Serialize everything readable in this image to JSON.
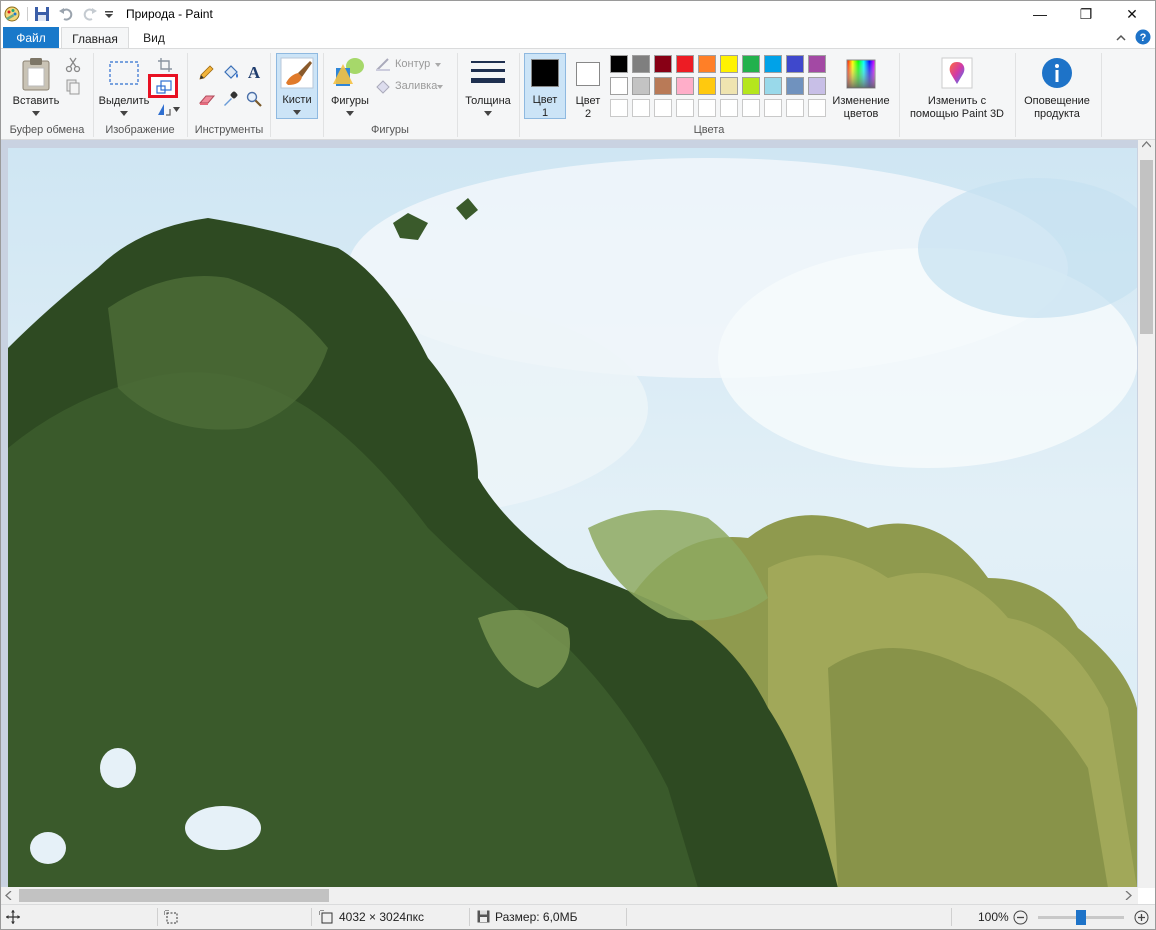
{
  "window": {
    "title": "Природа - Paint",
    "minimize": "—",
    "restore": "❐",
    "close": "✕"
  },
  "tabs": {
    "file": "Файл",
    "home": "Главная",
    "view": "Вид"
  },
  "ribbon": {
    "clipboard": {
      "group_label": "Буфер обмена",
      "paste": "Вставить"
    },
    "image": {
      "group_label": "Изображение",
      "select": "Выделить"
    },
    "tools": {
      "group_label": "Инструменты"
    },
    "brushes": {
      "label": "Кисти"
    },
    "shapes": {
      "group_label": "Фигуры",
      "shapes_label": "Фигуры",
      "outline": "Контур",
      "fill": "Заливка"
    },
    "size": {
      "label": "Толщина"
    },
    "colors": {
      "group_label": "Цвета",
      "color1_line1": "Цвет",
      "color1_line2": "1",
      "color2_line1": "Цвет",
      "color2_line2": "2",
      "color1_value": "#000000",
      "color2_value": "#ffffff",
      "edit_line1": "Изменение",
      "edit_line2": "цветов",
      "palette_row1": [
        "#000000",
        "#7f7f7f",
        "#880015",
        "#ed1c24",
        "#ff7f27",
        "#fff200",
        "#22b14c",
        "#00a2e8",
        "#3f48cc",
        "#a349a4"
      ],
      "palette_row2": [
        "#ffffff",
        "#c3c3c3",
        "#b97a57",
        "#ffaec9",
        "#ffc90e",
        "#efe4b0",
        "#b5e61d",
        "#99d9ea",
        "#7092be",
        "#c8bfe7"
      ]
    },
    "paint3d": {
      "line1": "Изменить с",
      "line2": "помощью Paint 3D"
    },
    "notify": {
      "line1": "Оповещение",
      "line2": "продукта"
    }
  },
  "statusbar": {
    "dimensions": "4032 × 3024пкс",
    "size": "Размер: 6,0МБ",
    "zoom": "100%",
    "zoom_level": 0.5
  },
  "colors": {
    "accent": "#1979ca",
    "highlight": "#e81123",
    "ribbon_bg": "#f5f6f7",
    "canvas_bg": "#c9d2e1"
  }
}
